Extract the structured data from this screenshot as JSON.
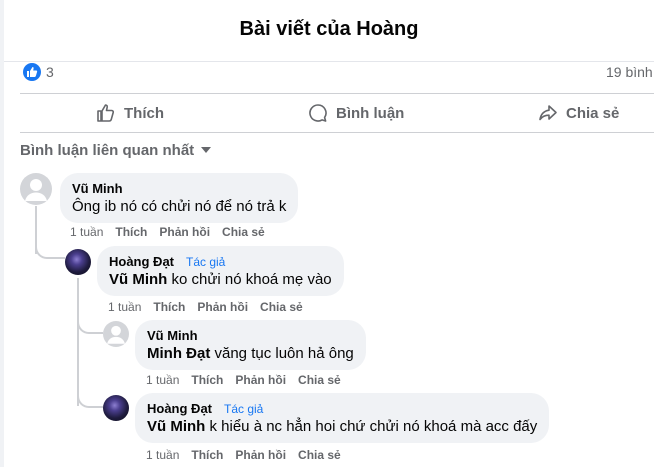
{
  "header": {
    "title": "Bài viết của Hoàng"
  },
  "summary": {
    "like_count": "3",
    "comment_count": "19 bình"
  },
  "actions": {
    "like": "Thích",
    "comment": "Bình luận",
    "share": "Chia sẻ"
  },
  "sort": {
    "label": "Bình luận liên quan nhất"
  },
  "colors": {
    "accent": "#1877f2",
    "bubble": "#f0f2f5",
    "meta": "#65676b"
  },
  "comments": [
    {
      "author": "Vũ Minh",
      "text": "Ông ib nó có chửi nó để nó trả k",
      "time": "1 tuần",
      "like": "Thích",
      "reply": "Phản hồi",
      "share": "Chia sẻ"
    },
    {
      "author": "Hoàng Đạt",
      "badge": "Tác giả",
      "mention": "Vũ Minh",
      "text": " ko chửi nó khoá mẹ vào",
      "time": "1 tuần",
      "like": "Thích",
      "reply": "Phản hồi",
      "share": "Chia sẻ"
    },
    {
      "author": "Vũ Minh",
      "mention": "Minh Đạt",
      "text": " văng tục luôn hả ông",
      "time": "1 tuần",
      "like": "Thích",
      "reply": "Phản hồi",
      "share": "Chia sẻ"
    },
    {
      "author": "Hoàng Đạt",
      "badge": "Tác giả",
      "mention": "Vũ Minh",
      "text": " k hiểu à nc hẳn hoi chứ chửi nó khoá mà acc đấy",
      "time": "1 tuần",
      "like": "Thích",
      "reply": "Phản hồi",
      "share": "Chia sẻ"
    }
  ]
}
